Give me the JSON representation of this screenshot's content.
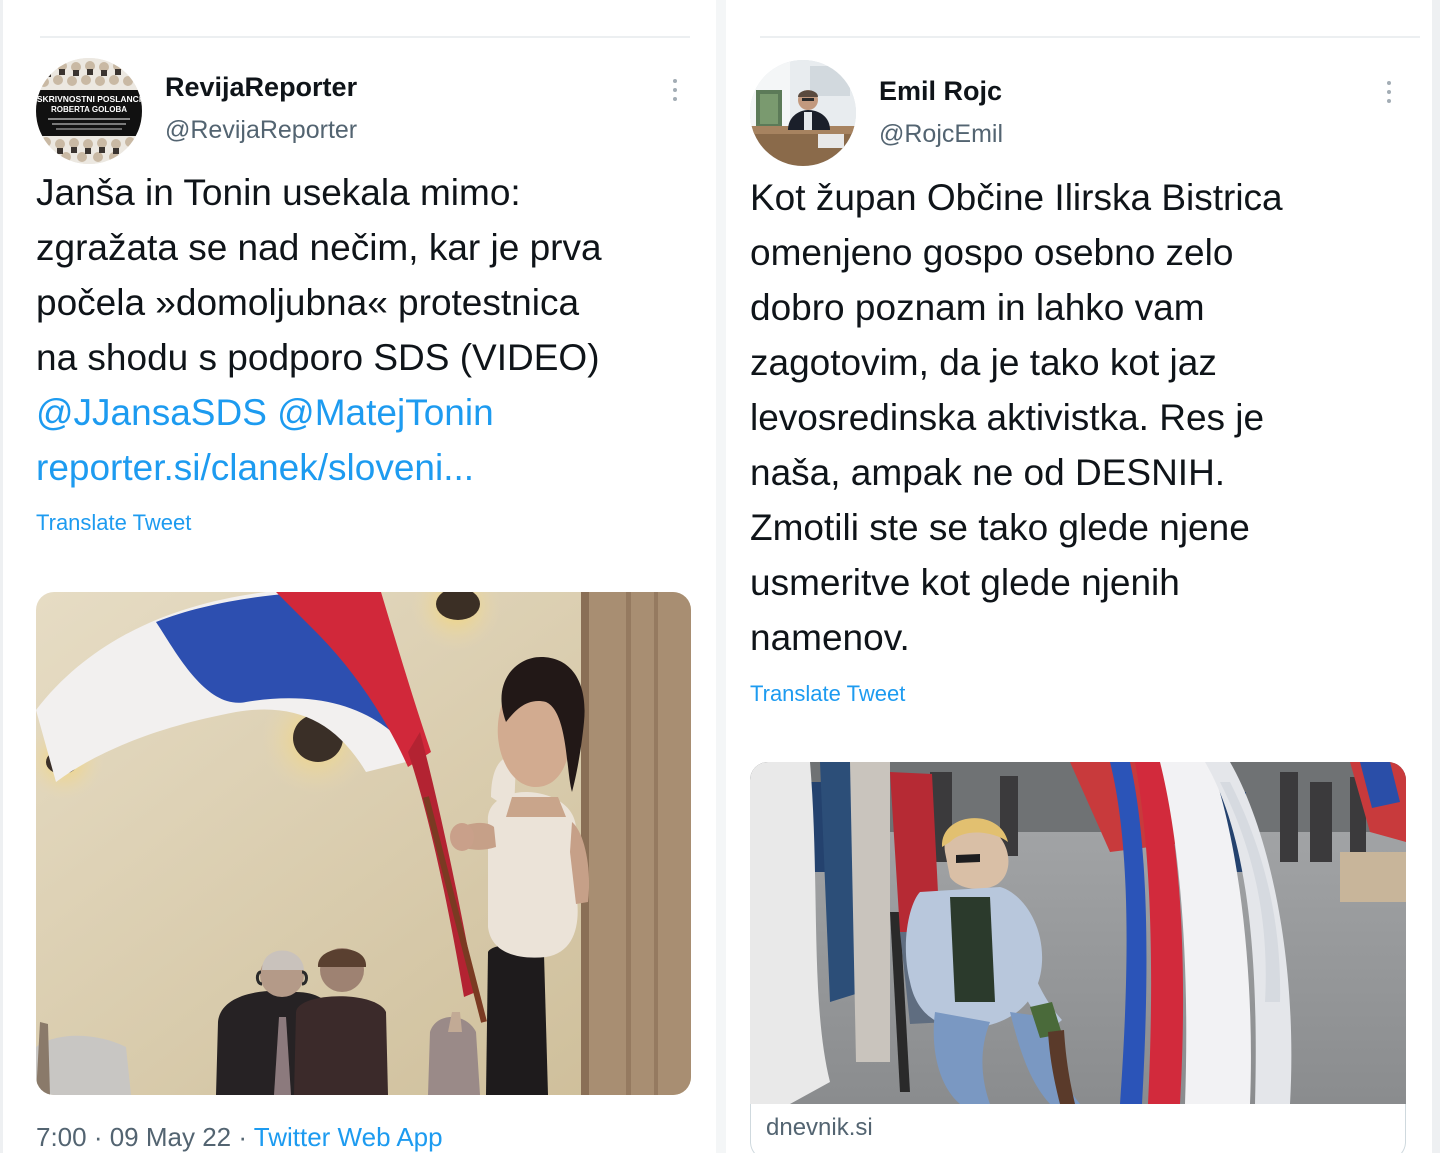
{
  "left_tweet": {
    "avatar_title_lines": [
      "SKRIVNOSTNI POSLANCI",
      "ROBERTA GOLOBA"
    ],
    "display_name": "RevijaReporter",
    "handle": "@RevijaReporter",
    "text_lines": [
      "Janša in Tonin usekala mimo:",
      "zgražata se nad nečim, kar je prva",
      "počela »domoljubna« protestnica",
      "na shodu s podporo SDS (VIDEO)"
    ],
    "mentions": [
      "@JJansaSDS",
      "@MatejTonin"
    ],
    "link_text": "reporter.si/clanek/sloveni...",
    "translate_label": "Translate Tweet",
    "timestamp": "7:00 · 09 May 22 · ",
    "source_app": "Twitter Web App"
  },
  "right_tweet": {
    "display_name": "Emil Rojc",
    "handle": "@RojcEmil",
    "text_lines": [
      "Kot župan Občine Ilirska Bistrica",
      "omenjeno gospo osebno zelo",
      "dobro poznam in lahko vam",
      "zagotovim, da je tako kot jaz",
      "levosredinska aktivistka. Res je",
      "naša, ampak ne od DESNIH.",
      "Zmotili ste se tako glede njene",
      "usmeritve kot glede njenih",
      "namenov."
    ],
    "translate_label": "Translate Tweet",
    "card_domain": "dnevnik.si"
  },
  "colors": {
    "accent": "#1d9bf0",
    "text_primary": "#0f1419",
    "text_secondary": "#536471",
    "flag_white": "#f4f4f6",
    "flag_blue": "#2a4fb0",
    "flag_red": "#d1283a"
  },
  "icons": {
    "more": "more-vertical-icon"
  }
}
